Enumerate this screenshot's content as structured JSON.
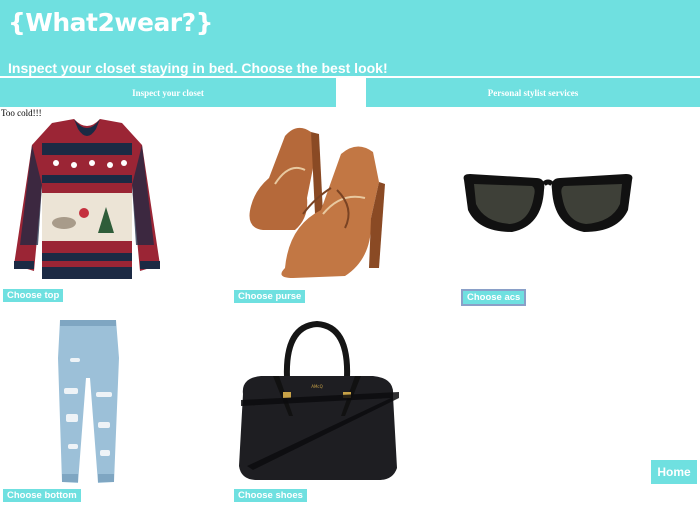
{
  "header": {
    "logo": "{What2wear?}",
    "tagline": "Inspect your closet staying in bed. Choose the best look!"
  },
  "nav": {
    "inspect_closet": "Inspect your closet",
    "stylist": "Personal stylist services"
  },
  "weather_note": "Too cold!!!",
  "items": {
    "top": {
      "image": "christmas-sweater-icon",
      "button": "Choose top"
    },
    "purse": {
      "image": "oxford-heels-icon",
      "button": "Choose purse"
    },
    "acs": {
      "image": "sunglasses-icon",
      "button": "Choose acs"
    },
    "bottom": {
      "image": "ripped-jeans-icon",
      "button": "Choose bottom"
    },
    "shoes": {
      "image": "black-handbag-icon",
      "button": "Choose shoes"
    }
  },
  "home_button": "Home",
  "colors": {
    "accent": "#6fe0e0",
    "sweater_red": "#9b2535",
    "sweater_navy": "#1c2a44",
    "leather_tan": "#b5693a",
    "denim": "#9cc0d8"
  }
}
